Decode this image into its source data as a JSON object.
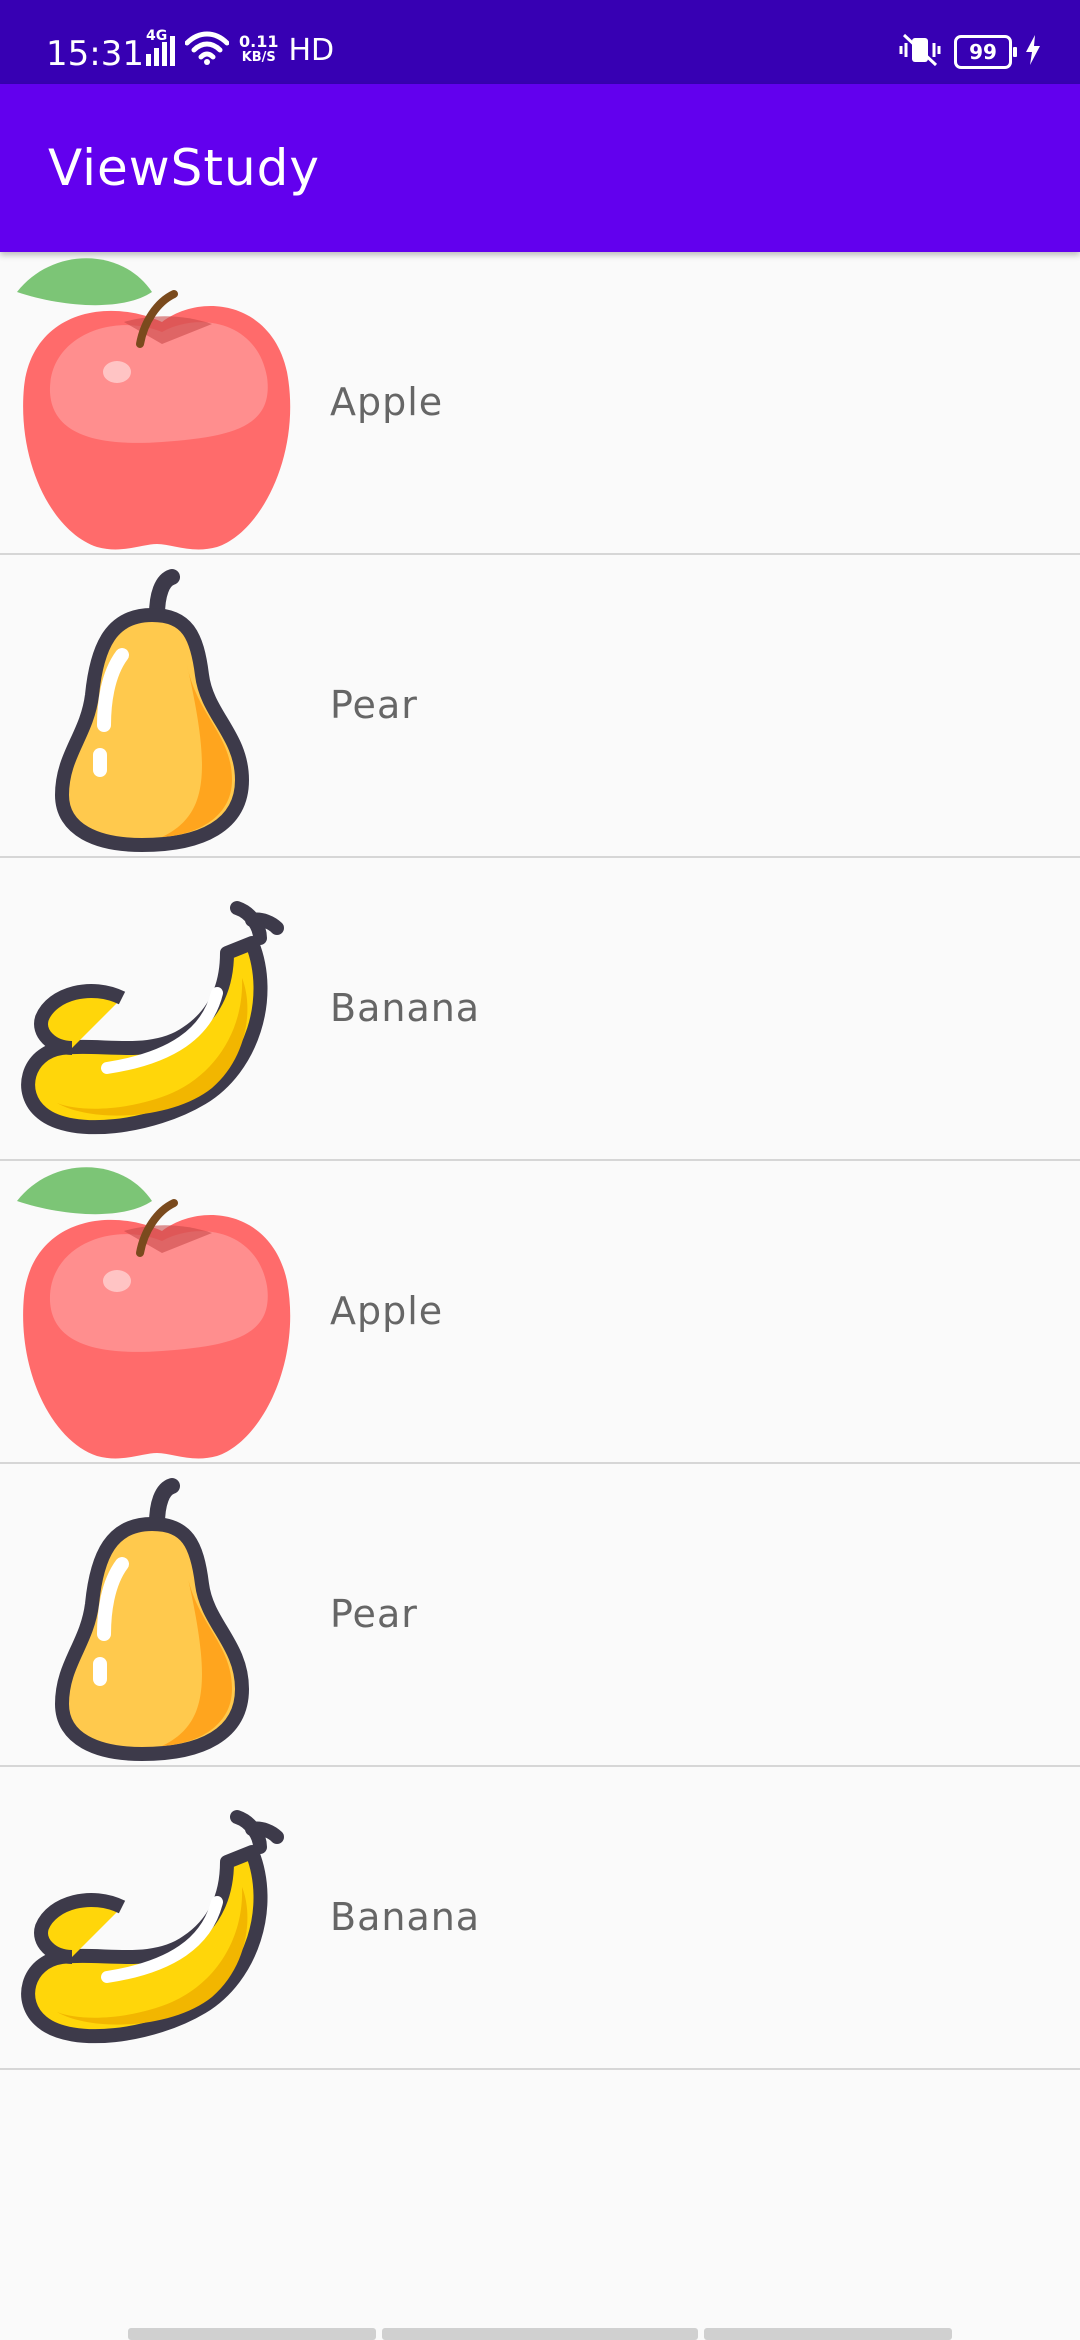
{
  "status_bar": {
    "time": "15:31",
    "network_type": "4G",
    "net_speed_value": "0.11",
    "net_speed_unit": "KB/S",
    "hd_label": "HD",
    "battery_level": "99",
    "icons": [
      "signal-icon",
      "wifi-icon",
      "vibrate-icon",
      "battery-icon",
      "charging-icon"
    ]
  },
  "app_bar": {
    "title": "ViewStudy",
    "color": "#6200ee",
    "status_color": "#3700b3"
  },
  "fruits": [
    {
      "label": "Apple",
      "icon": "apple-icon"
    },
    {
      "label": "Pear",
      "icon": "pear-icon"
    },
    {
      "label": "Banana",
      "icon": "banana-icon"
    },
    {
      "label": "Apple",
      "icon": "apple-icon"
    },
    {
      "label": "Pear",
      "icon": "pear-icon"
    },
    {
      "label": "Banana",
      "icon": "banana-icon"
    }
  ]
}
